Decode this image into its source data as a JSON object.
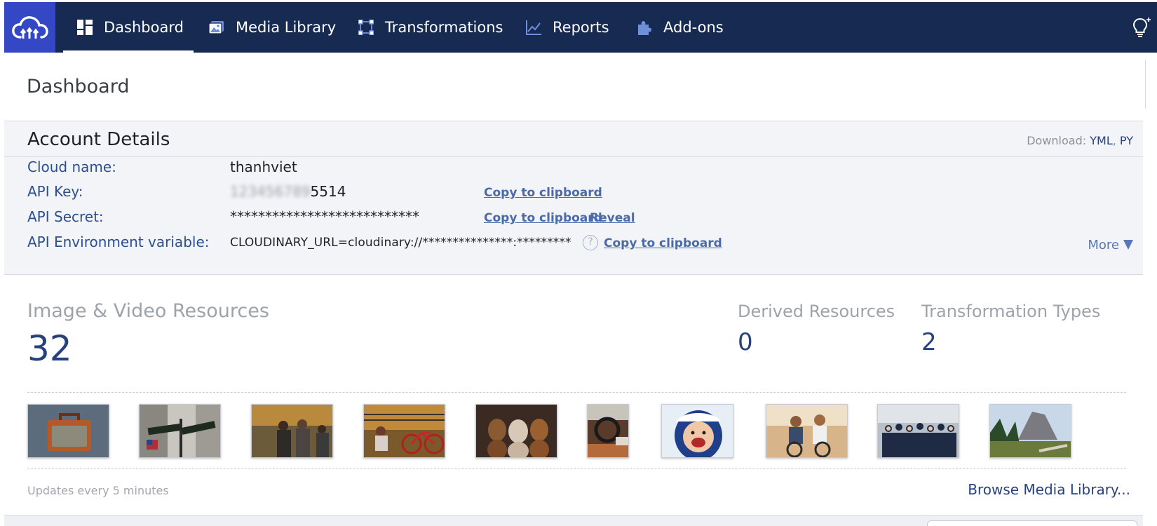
{
  "nav": {
    "items": [
      {
        "label": "Dashboard",
        "icon": "dashboard-icon",
        "active": true
      },
      {
        "label": "Media Library",
        "icon": "media-library-icon",
        "active": false
      },
      {
        "label": "Transformations",
        "icon": "transformations-icon",
        "active": false
      },
      {
        "label": "Reports",
        "icon": "reports-icon",
        "active": false
      },
      {
        "label": "Add-ons",
        "icon": "puzzle-icon",
        "active": false
      }
    ],
    "logo_icon": "cloudinary-logo-icon",
    "tips_icon": "lightbulb-icon"
  },
  "page": {
    "title": "Dashboard"
  },
  "account": {
    "title": "Account Details",
    "download_label": "Download:",
    "download_yml": "YML",
    "download_sep": ",",
    "download_py": "PY",
    "cloud_name_label": "Cloud name:",
    "cloud_name_value": "thanhviet",
    "api_key_label": "API Key:",
    "api_key_hidden": "123456789",
    "api_key_suffix": "5514",
    "api_secret_label": "API Secret:",
    "api_secret_value": "***************************",
    "env_label": "API Environment variable:",
    "env_value": "CLOUDINARY_URL=cloudinary://***************:*************",
    "help_glyph": "?",
    "copy_label": "Copy to clipboard",
    "reveal_label": "Reveal",
    "more_label": "More"
  },
  "resources": {
    "image_video_label": "Image & Video Resources",
    "image_video_count": "32",
    "derived_label": "Derived Resources",
    "derived_count": "0",
    "transformation_label": "Transformation Types",
    "transformation_count": "2",
    "thumbnails": [
      "briefcase",
      "street-signs",
      "musicians",
      "woman-bicycle",
      "three-dogs",
      "car-interior",
      "child-snow",
      "couple-bikes",
      "team-photo",
      "mountain-valley"
    ],
    "updates_text": "Updates every 5 minutes",
    "browse_label": "Browse Media Library..."
  },
  "colors": {
    "nav_bg": "#172b52",
    "logo_bg": "#3448c5",
    "label_blue": "#2c4f8d",
    "link_blue": "#4b6aa8",
    "count_blue": "#27417c"
  }
}
